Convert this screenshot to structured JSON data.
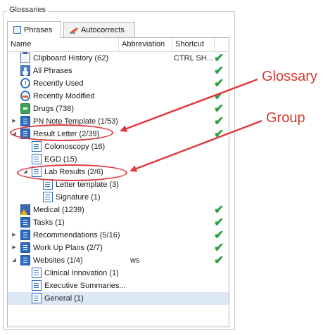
{
  "groupbox": {
    "title": "Glossaries"
  },
  "tabs": [
    {
      "label": "Phrases",
      "icon": "phrases-icon",
      "active": true
    },
    {
      "label": "Autocorrects",
      "icon": "autocorrect-pencil-icon",
      "active": false
    }
  ],
  "columns": [
    "Name",
    "Abbreviation",
    "Shortcut"
  ],
  "rows": [
    {
      "label": "Clipboard History (62)",
      "icon": "clipboard",
      "shortcut": "CTRL SH...",
      "check": true
    },
    {
      "label": "All Phrases",
      "icon": "person",
      "check": true
    },
    {
      "label": "Recently Used",
      "icon": "clock",
      "check": true
    },
    {
      "label": "Recently Modified",
      "icon": "modified",
      "check": true
    },
    {
      "label": "Drugs (738)",
      "icon": "drugs",
      "check": true
    },
    {
      "label": "PN Note Template (1/53)",
      "icon": "glossary",
      "expander": "collapsed",
      "check": true
    },
    {
      "label": "Result Letter (2/39)",
      "icon": "glossary",
      "expander": "expanded",
      "check": true
    },
    {
      "label": "Colonoscopy (16)",
      "icon": "group"
    },
    {
      "label": "EGD (15)",
      "icon": "group"
    },
    {
      "label": "Lab Results (2/6)",
      "icon": "group",
      "expander": "expanded"
    },
    {
      "label": "Letter template (3)",
      "icon": "group"
    },
    {
      "label": "Signature (1)",
      "icon": "group"
    },
    {
      "label": "Medical (1239)",
      "icon": "medical",
      "check": true
    },
    {
      "label": "Tasks (1)",
      "icon": "glossary",
      "check": true
    },
    {
      "label": "Recommendations (5/16)",
      "icon": "glossary",
      "expander": "collapsed",
      "check": true
    },
    {
      "label": "Work Up Plans (2/7)",
      "icon": "glossary",
      "expander": "collapsed",
      "check": true
    },
    {
      "label": "Websites (1/4)",
      "icon": "glossary",
      "expander": "expanded",
      "abbreviation": "ws",
      "check": true
    },
    {
      "label": "Clinical Innovation (1)",
      "icon": "group"
    },
    {
      "label": "Executive Summaries...",
      "icon": "group"
    },
    {
      "label": "General (1)",
      "icon": "group",
      "selected": true
    }
  ],
  "annotations": {
    "glossary": "Glossary",
    "group": "Group",
    "color": "#e0393e"
  },
  "colors": {
    "check": "#2ea043",
    "glossary_icon": "#2b6cc4",
    "selection": "#dde8f5"
  }
}
